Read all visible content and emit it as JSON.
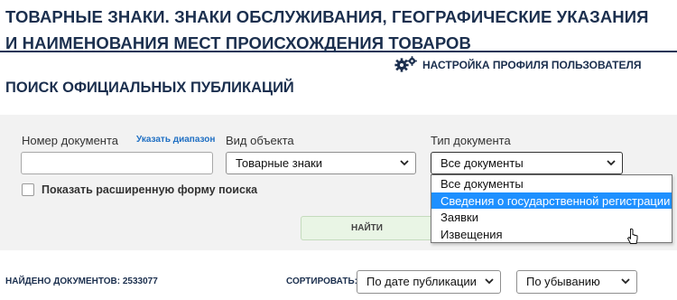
{
  "header": {
    "title": "ТОВАРНЫЕ ЗНАКИ. ЗНАКИ ОБСЛУЖИВАНИЯ, ГЕОГРАФИЧЕСКИЕ УКАЗАНИЯ И НАИМЕНОВАНИЯ МЕСТ ПРОИСХОЖДЕНИЯ ТОВАРОВ"
  },
  "profile": {
    "link_label": "НАСТРОЙКА ПРОФИЛЯ ПОЛЬЗОВАТЕЛЯ",
    "icon": "gears-icon"
  },
  "section_title": "ПОИСК ОФИЦИАЛЬНЫХ ПУБЛИКАЦИЙ",
  "search": {
    "doc_number_label": "Номер документа",
    "range_link": "Указать диапазон",
    "doc_number_value": "",
    "object_type_label": "Вид объекта",
    "object_type_value": "Товарные знаки",
    "doc_type_label": "Тип документа",
    "doc_type_value": "Все документы",
    "doc_type_options": [
      "Все документы",
      "Сведения о государственной регистрации",
      "Заявки",
      "Извещения"
    ],
    "highlighted_option_index": 1,
    "extended_form_label": "Показать расширенную форму поиска",
    "extended_form_checked": false,
    "find_button": "НАЙТИ"
  },
  "results": {
    "found_label": "НАЙДЕНО ДОКУМЕНТОВ: 2533077",
    "sort_label": "СОРТИРОВАТЬ:",
    "sort_by_value": "По дате публикации",
    "sort_order_value": "По убыванию"
  },
  "colors": {
    "heading": "#1b2f4e",
    "link": "#1f6fc3",
    "panel_bg": "#f2f2f2",
    "find_button_bg": "#e9f5e5",
    "selected_option": "#1e90ff"
  }
}
